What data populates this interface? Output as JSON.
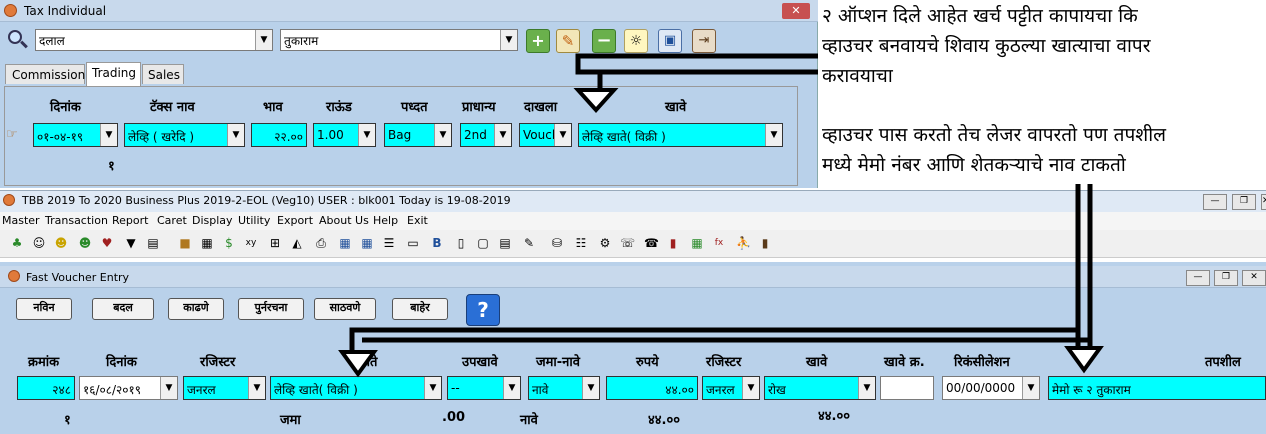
{
  "tax_window": {
    "title": "Tax Individual",
    "close_label": "✕",
    "search_left_value": "दलाल",
    "search_right_value": "तुकाराम",
    "tabs": [
      "Commission",
      "Trading",
      "Sales"
    ],
    "columns": [
      "दिनांक",
      "टॅक्स नाव",
      "भाव",
      "राऊंड",
      "पध्दत",
      "प्राधान्य",
      "दाखला",
      "खावे"
    ],
    "row": {
      "date": "०१-०४-१९",
      "tax_name": "लेव्हि ( खरेदि )",
      "rate": "२२.००",
      "round": "1.00",
      "method": "Bag",
      "priority": "2nd",
      "dakhala": "Vouch",
      "khave": "लेव्हि खाते( विक्री )"
    },
    "count": "१"
  },
  "notes": {
    "line1": "२ ऑप्शन दिले आहेत खर्च पट्टीत कापायचा कि",
    "line2": "व्हाउचर बनवायचे शिवाय कुठल्या खात्याचा वापर",
    "line3": "करावयाचा",
    "line4": "व्हाउचर पास करतो तेच लेजर वापरतो पण तपशील",
    "line5": "मध्ये मेमो नंबर आणि शेतकऱ्याचे नाव टाकतो"
  },
  "main_window": {
    "title": "TBB 2019 To 2020 Business Plus 2019-2-EOL (Veg10)  USER : blk001 Today is 19-08-2019",
    "menu": [
      "Master",
      "Transaction",
      "Report",
      "Caret",
      "Display",
      "Utility",
      "Export",
      "About Us",
      "Help",
      "Exit"
    ]
  },
  "fv_window": {
    "title": "Fast Voucher Entry",
    "buttons": [
      "नविन",
      "बदल",
      "काढणे",
      "पुर्नरचना",
      "साठवणे",
      "बाहेर"
    ],
    "help_label": "?",
    "columns": [
      "क्रमांक",
      "दिनांक",
      "रजिस्टर",
      "खाते",
      "उपखावे",
      "जमा-नावे",
      "रुपये",
      "रजिस्टर",
      "खावे",
      "खावे क्र.",
      "रिकंसीलेशन",
      "तपशील"
    ],
    "row": {
      "number": "२४८",
      "date": "१६/०८/२०१९",
      "register": "जनरल",
      "account": "लेव्हि खाते( विक्री )",
      "subaccount": "--",
      "cr_dr": "नावे",
      "amount": "४४.००",
      "register2": "जनरल",
      "khave": "रोख",
      "khave_no": "",
      "reconciliation": "00/00/0000",
      "details": "मेमो रू २ तुकाराम"
    },
    "footer": {
      "count": "१",
      "jama_label": "जमा",
      "jama_value": ".00",
      "nave_label": "नावे",
      "nave_value": "४४.००",
      "total": "४४.००"
    }
  }
}
